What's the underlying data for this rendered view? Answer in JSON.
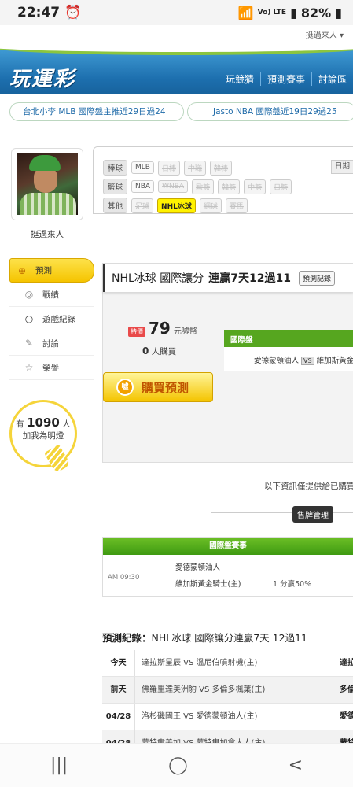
{
  "status": {
    "time": "22:47",
    "network": "Vo) LTE",
    "battery": "82%"
  },
  "header": {
    "user_link": "挺過來人 ▾",
    "logo": "玩運彩",
    "nav": [
      "玩競猜",
      "預測賽事",
      "討論區"
    ]
  },
  "ticker": [
    "台北小李  MLB  國際盤主推近29日過24",
    "Jasto  NBA  國際盤近19日29過25"
  ],
  "sidebar": {
    "username": "挺過來人",
    "menu": [
      {
        "label": "預測",
        "icon": "target-icon"
      },
      {
        "label": "戰績",
        "icon": "chat-icon"
      },
      {
        "label": "遊戲紀錄",
        "icon": "circle-icon"
      },
      {
        "label": "討論",
        "icon": "edit-icon"
      },
      {
        "label": "榮譽",
        "icon": "medal-icon"
      }
    ],
    "fans_prefix": "有",
    "fans_count": "1090",
    "fans_suffix": "人",
    "fans_text": "加我為明燈"
  },
  "categories": {
    "rows": [
      {
        "label": "棒球",
        "tags": [
          {
            "t": "MLB",
            "s": "on"
          },
          {
            "t": "日棒",
            "s": "off"
          },
          {
            "t": "中職",
            "s": "off"
          },
          {
            "t": "韓棒",
            "s": "off"
          }
        ]
      },
      {
        "label": "籃球",
        "tags": [
          {
            "t": "NBA",
            "s": "on"
          },
          {
            "t": "WNBA",
            "s": "off"
          },
          {
            "t": "歐籃",
            "s": "off"
          },
          {
            "t": "韓籃",
            "s": "off"
          },
          {
            "t": "中籃",
            "s": "off"
          },
          {
            "t": "日籃",
            "s": "off"
          }
        ]
      },
      {
        "label": "其他",
        "tags": [
          {
            "t": "足球",
            "s": "off"
          },
          {
            "t": "NHL冰球",
            "s": "sel"
          },
          {
            "t": "網球",
            "s": "off"
          },
          {
            "t": "賽馬",
            "s": "off"
          }
        ]
      }
    ],
    "date_btn": "日期"
  },
  "prediction": {
    "title_prefix": "NHL冰球 國際讓分",
    "title_bold": "連贏7天12過11",
    "record_btn": "預測記錄",
    "badge": "特價",
    "price": "79",
    "unit": "元噓幣",
    "buyers_count": "0",
    "buyers_suffix": "人購買",
    "buy_btn": "購買預測",
    "coin": "噓",
    "intl_header": "國際盤",
    "intl_team1": "愛德蒙頓油人",
    "vs": "VS",
    "intl_team2": "維加斯黃金"
  },
  "notice": "以下資訊僅提供給已購買",
  "sell_btn": "售牌管理",
  "game_table": {
    "header": "國際盤賽事",
    "time": "AM 09:30",
    "team1": "愛德蒙頓油人",
    "team2": "維加斯黃金騎士(主)",
    "odds": "1 分贏50%"
  },
  "record_title_label": "預測紀錄：",
  "record_title_rest": "NHL冰球 國際讓分連贏7天 12過11",
  "records": [
    {
      "date": "今天",
      "match": "達拉斯星辰 VS 溫尼伯噴射機(主)",
      "result": "達拉"
    },
    {
      "date": "前天",
      "match": "佛羅里達美洲豹 VS 多倫多楓葉(主)",
      "result": "多倫"
    },
    {
      "date": "04/28",
      "match": "洛杉磯國王 VS 愛德蒙頓油人(主)",
      "result": "愛德"
    },
    {
      "date": "04/28",
      "match": "蒙特婁美加 VS 蒙特婁加拿大人(主)",
      "result": "蒙特"
    }
  ],
  "navbar": [
    "|||",
    "◯",
    "<"
  ]
}
